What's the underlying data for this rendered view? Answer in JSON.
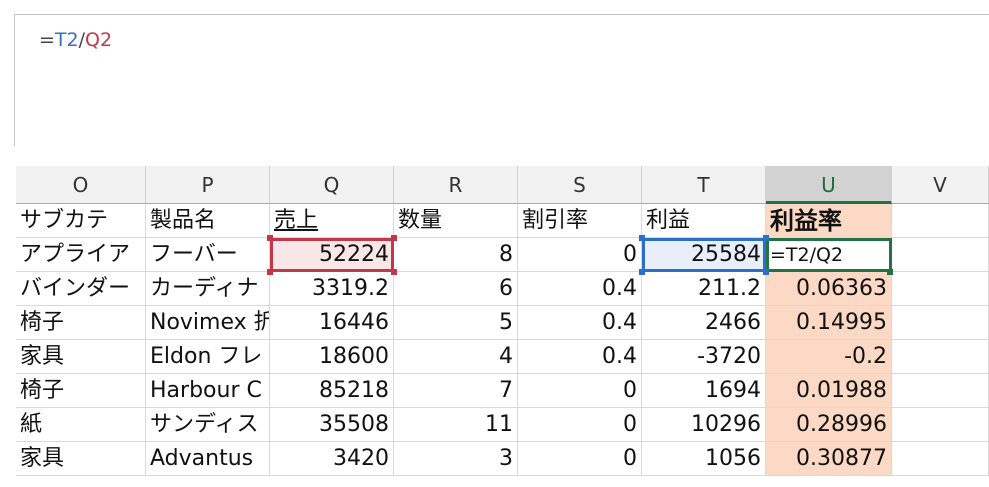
{
  "formula": {
    "prefix": "=",
    "ref1": "T2",
    "op": "/",
    "ref2": "Q2"
  },
  "columns": [
    "O",
    "P",
    "Q",
    "R",
    "S",
    "T",
    "U",
    "V"
  ],
  "header_row": [
    "サブカテ",
    "製品名",
    "売上",
    "数量",
    "割引率",
    "利益",
    "利益率"
  ],
  "rows": [
    {
      "o": "アプライア",
      "p": "フーバー",
      "q": "52224",
      "r": "8",
      "s": "0",
      "t": "25584",
      "u": "=T2/Q2"
    },
    {
      "o": "バインダー",
      "p": "カーディナ",
      "q": "3319.2",
      "r": "6",
      "s": "0.4",
      "t": "211.2",
      "u": "0.06363"
    },
    {
      "o": "椅子",
      "p": "Novimex 折",
      "q": "16446",
      "r": "5",
      "s": "0.4",
      "t": "2466",
      "u": "0.14995"
    },
    {
      "o": "家具",
      "p": "Eldon フレ",
      "q": "18600",
      "r": "4",
      "s": "0.4",
      "t": "-3720",
      "u": "-0.2"
    },
    {
      "o": "椅子",
      "p": "Harbour C",
      "q": "85218",
      "r": "7",
      "s": "0",
      "t": "1694",
      "u": "0.01988"
    },
    {
      "o": "紙",
      "p": "サンディス",
      "q": "35508",
      "r": "11",
      "s": "0",
      "t": "10296",
      "u": "0.28996"
    },
    {
      "o": "家具",
      "p": "Advantus",
      "q": "3420",
      "r": "3",
      "s": "0",
      "t": "1056",
      "u": "0.30877"
    }
  ],
  "colors": {
    "selected_header": "#217346",
    "u_fill": "#fbd9c5",
    "ref_q": "#c0394b",
    "ref_t": "#2c6fc6"
  }
}
